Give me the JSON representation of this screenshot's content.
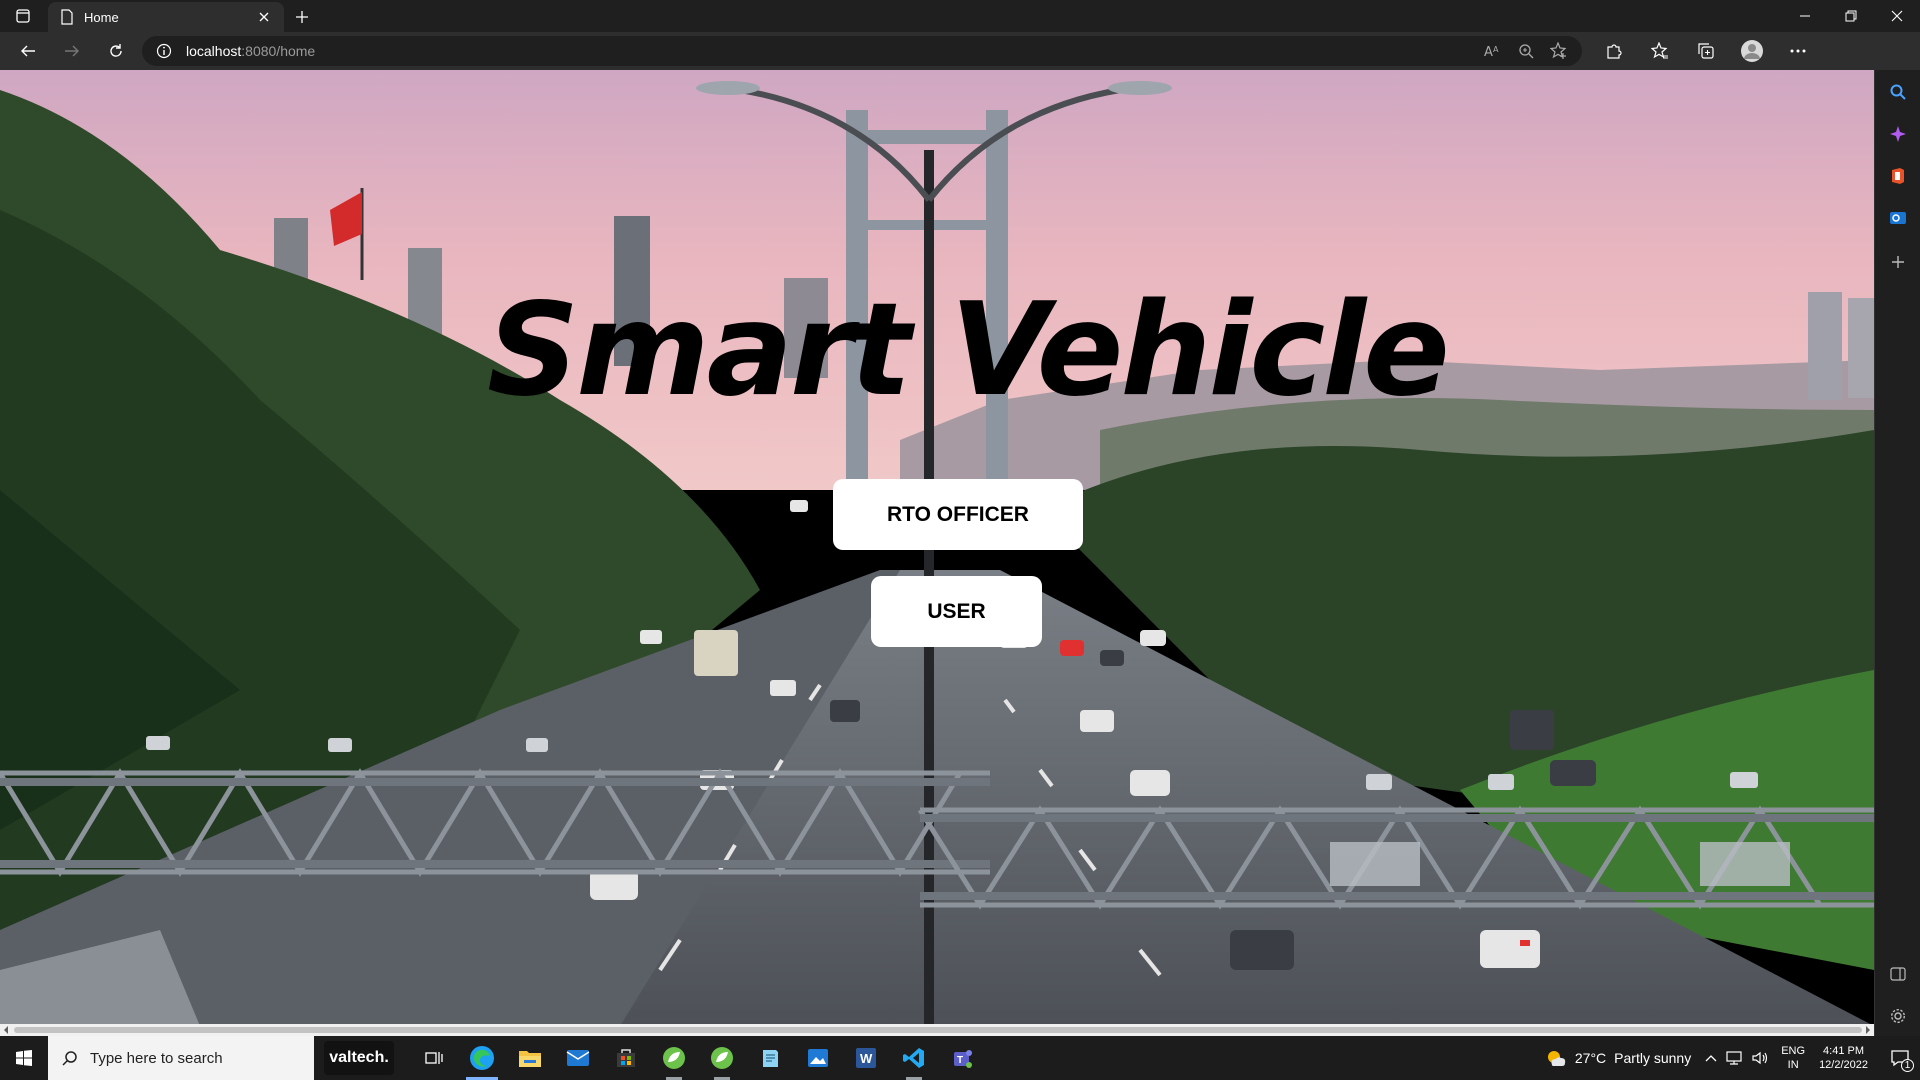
{
  "browser": {
    "tab": {
      "title": "Home"
    },
    "address": {
      "host": "localhost",
      "path": ":8080/home"
    }
  },
  "page": {
    "title": "Smart Vehicle",
    "buttons": {
      "rto": "RTO OFFICER",
      "user": "USER"
    }
  },
  "taskbar": {
    "search_placeholder": "Type here to search",
    "valtech_label": "valtech.",
    "weather": {
      "temp": "27°C",
      "condition": "Partly sunny"
    },
    "language": {
      "line1": "ENG",
      "line2": "IN"
    },
    "clock": {
      "time": "4:41 PM",
      "date": "12/2/2022"
    },
    "notification_count": "1"
  },
  "colors": {
    "browser_dark": "#1f1f1f",
    "toolbar": "#2e2e2e",
    "button_bg": "#ffffff",
    "title_text": "#000000",
    "sky_pink": "#e9b6bf",
    "accent_blue": "#7fb5ff"
  }
}
